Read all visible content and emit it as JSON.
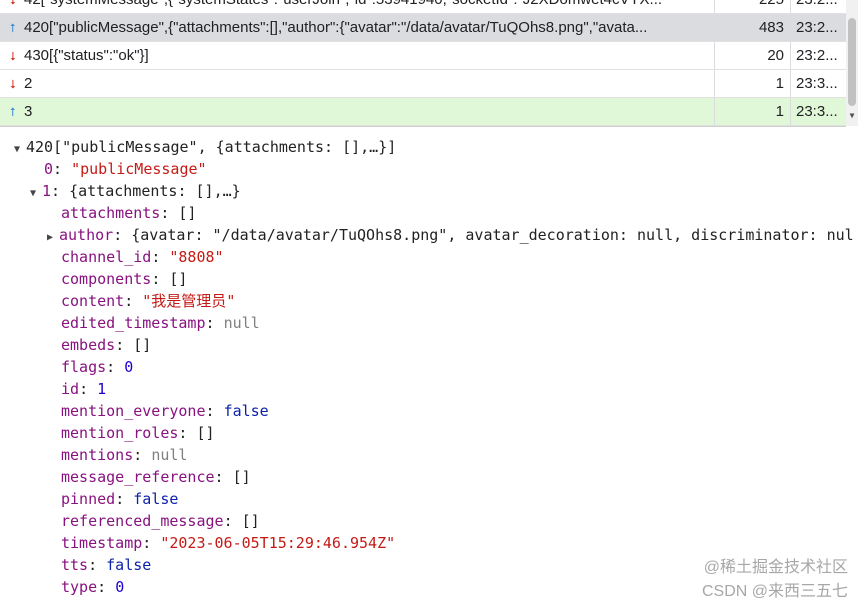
{
  "frames": {
    "rows": [
      {
        "dir": "down",
        "data": "42[\"systemMessage\",{\"systemStates\":\"userJoin\",\"id\":53941940,\"socketId\":\"J2XDomwet4cVYX...",
        "length": "225",
        "time": "23:2..."
      },
      {
        "dir": "up",
        "data": "420[\"publicMessage\",{\"attachments\":[],\"author\":{\"avatar\":\"/data/avatar/TuQOhs8.png\",\"avata...",
        "length": "483",
        "time": "23:2..."
      },
      {
        "dir": "down",
        "data": "430[{\"status\":\"ok\"}]",
        "length": "20",
        "time": "23:2..."
      },
      {
        "dir": "down",
        "data": "2",
        "length": "1",
        "time": "23:3..."
      },
      {
        "dir": "up",
        "data": "3",
        "length": "1",
        "time": "23:3..."
      }
    ],
    "arrow_up_glyph": "⭡",
    "arrow_down_glyph": "⭣"
  },
  "tree": {
    "root": "420[\"publicMessage\", {attachments: [],…}]",
    "item0_index": "0",
    "item0_value": "\"publicMessage\"",
    "item1_index": "1",
    "item1_value": "{attachments: [],…}",
    "props": {
      "attachments": {
        "key": "attachments",
        "value": "[]"
      },
      "author": {
        "key": "author",
        "value": "{avatar: \"/data/avatar/TuQOhs8.png\", avatar_decoration: null, discriminator: nul"
      },
      "channel_id": {
        "key": "channel_id",
        "value": "\"8808\""
      },
      "components": {
        "key": "components",
        "value": "[]"
      },
      "content": {
        "key": "content",
        "value": "\"我是管理员\""
      },
      "edited_timestamp": {
        "key": "edited_timestamp",
        "value": "null"
      },
      "embeds": {
        "key": "embeds",
        "value": "[]"
      },
      "flags": {
        "key": "flags",
        "value": "0"
      },
      "id": {
        "key": "id",
        "value": "1"
      },
      "mention_everyone": {
        "key": "mention_everyone",
        "value": "false"
      },
      "mention_roles": {
        "key": "mention_roles",
        "value": "[]"
      },
      "mentions": {
        "key": "mentions",
        "value": "null"
      },
      "message_reference": {
        "key": "message_reference",
        "value": "[]"
      },
      "pinned": {
        "key": "pinned",
        "value": "false"
      },
      "referenced_message": {
        "key": "referenced_message",
        "value": "[]"
      },
      "timestamp": {
        "key": "timestamp",
        "value": "\"2023-06-05T15:29:46.954Z\""
      },
      "tts": {
        "key": "tts",
        "value": "false"
      },
      "type": {
        "key": "type",
        "value": "0"
      }
    }
  },
  "colors": {
    "selected_row": "#dadce0",
    "highlight_row": "#e1f8d8",
    "string": "#c41a16",
    "number": "#1c00cf",
    "key": "#881280"
  },
  "watermark": {
    "line1": "@稀土掘金技术社区",
    "line2": "CSDN @来西三五七"
  }
}
